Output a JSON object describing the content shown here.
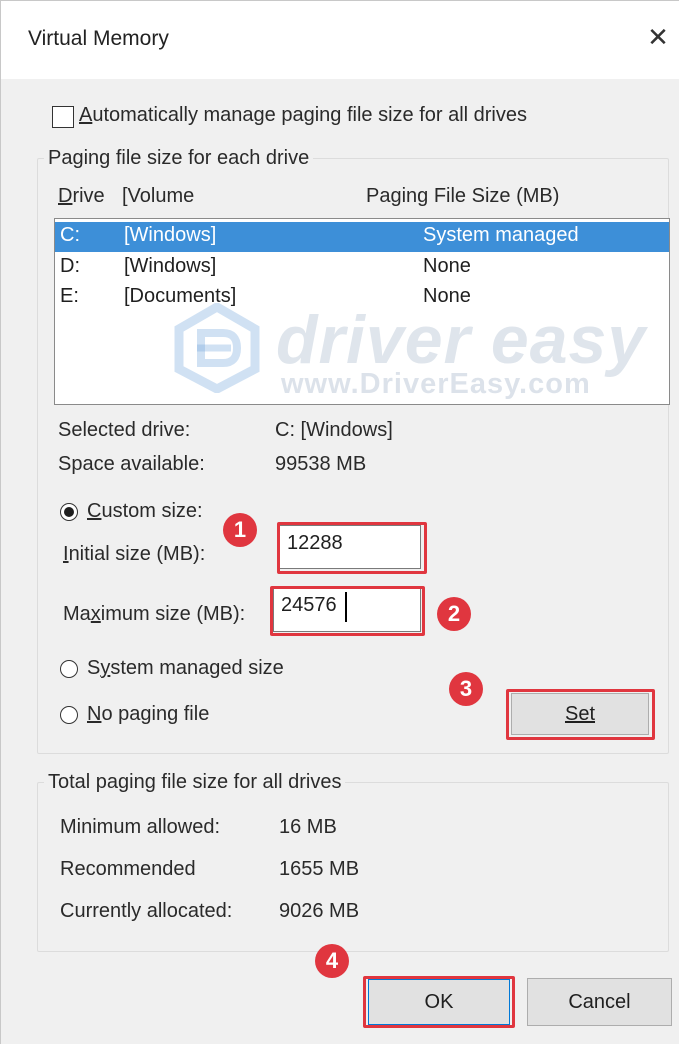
{
  "window": {
    "title": "Virtual Memory"
  },
  "auto_manage": {
    "label": "Automatically manage paging file size for all drives",
    "checked": false
  },
  "paging_group": {
    "title": "Paging file size for each drive",
    "headers": {
      "drive": "Drive",
      "volume": "[Volume",
      "size": "Paging File Size (MB)"
    },
    "drives": [
      {
        "letter": "C:",
        "volume": "[Windows]",
        "size": "System managed",
        "selected": true
      },
      {
        "letter": "D:",
        "volume": "[Windows]",
        "size": "None",
        "selected": false
      },
      {
        "letter": "E:",
        "volume": "[Documents]",
        "size": "None",
        "selected": false
      }
    ],
    "selected_drive_label": "Selected drive:",
    "selected_drive_value": "C:  [Windows]",
    "space_available_label": "Space available:",
    "space_available_value": "99538 MB",
    "custom_size_label": "Custom size:",
    "initial_size_label": "Initial size (MB):",
    "initial_size_value": "12288",
    "maximum_size_label": "Maximum size (MB):",
    "maximum_size_value": "24576",
    "system_managed_label": "System managed size",
    "no_paging_label": "No paging file",
    "set_label": "Set",
    "selected_option": "custom"
  },
  "total_group": {
    "title": "Total paging file size for all drives",
    "rows": [
      {
        "label": "Minimum allowed:",
        "value": "16 MB"
      },
      {
        "label": "Recommended",
        "value": "1655 MB"
      },
      {
        "label": "Currently allocated:",
        "value": "9026 MB"
      }
    ]
  },
  "buttons": {
    "ok": "OK",
    "cancel": "Cancel"
  },
  "annotations": {
    "step1": "1",
    "step2": "2",
    "step3": "3",
    "step4": "4",
    "color": "#e0363f"
  },
  "watermark": {
    "brand": "driver easy",
    "url": "www.DriverEasy.com"
  },
  "colors": {
    "selection": "#3d8fd8",
    "dialog_bg": "#f0f0f0"
  }
}
